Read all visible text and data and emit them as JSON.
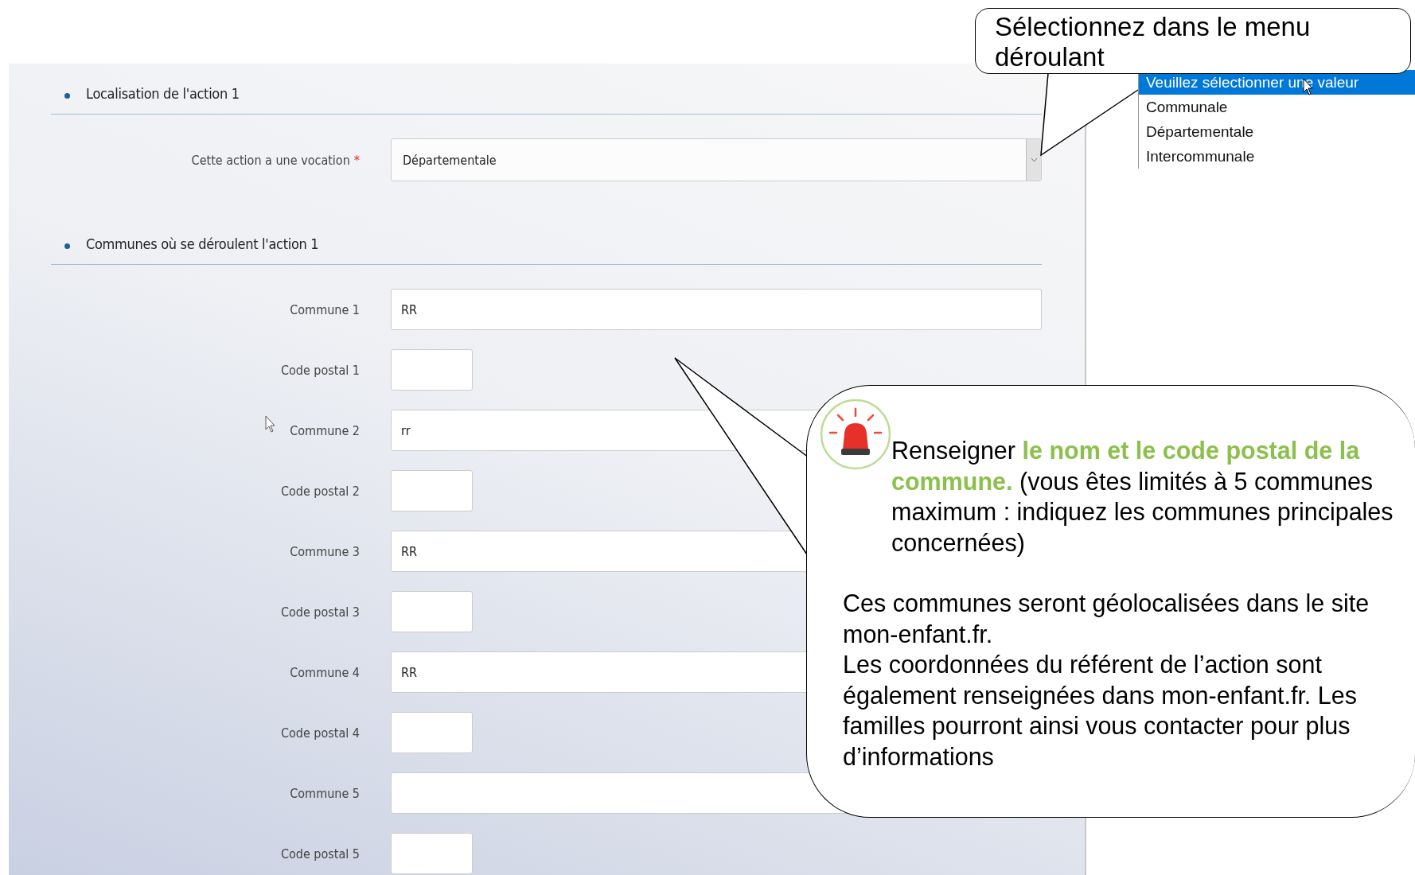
{
  "sections": [
    {
      "title": "Localisation de l'action 1",
      "fields": [
        {
          "kind": "select",
          "label": "Cette action a une vocation",
          "required_mark": "*",
          "value": "Départementale"
        }
      ]
    },
    {
      "title": "Communes où se déroulent l'action 1",
      "fields": [
        {
          "kind": "wide",
          "label": "Commune 1",
          "value": "RR"
        },
        {
          "kind": "short",
          "label": "Code postal 1"
        },
        {
          "kind": "wide",
          "label": "Commune 2",
          "value": "rr"
        },
        {
          "kind": "short",
          "label": "Code postal 2"
        },
        {
          "kind": "wide",
          "label": "Commune 3",
          "value": "RR"
        },
        {
          "kind": "short",
          "label": "Code postal 3"
        },
        {
          "kind": "wide",
          "label": "Commune 4",
          "value": "RR"
        },
        {
          "kind": "short",
          "label": "Code postal 4"
        },
        {
          "kind": "wide",
          "label": "Commune 5"
        },
        {
          "kind": "short",
          "label": "Code postal 5"
        }
      ]
    }
  ],
  "dropdown": {
    "options": [
      {
        "label": "Veuillez sélectionner une valeur",
        "selected": true
      },
      {
        "label": "Communale",
        "selected": false
      },
      {
        "label": "Départementale",
        "selected": false
      },
      {
        "label": "Intercommunale",
        "selected": false
      }
    ]
  },
  "callouts": [
    {
      "kind": "plain",
      "text": "Sélectionnez dans le menu déroulant"
    },
    {
      "kind": "alert",
      "text": "Renseigner **le nom et le code postal de la commune.**  (vous êtes limités à 5 communes maximum : indiquez les communes principales concernées)",
      "lines": [
        "Ces communes seront géolocalisées dans le site mon-enfant.fr.",
        "Les coordonnées du référent de l’action sont également renseignées dans mon-enfant.fr. Les familles pourront ainsi vous contacter pour plus d’informations"
      ]
    }
  ]
}
